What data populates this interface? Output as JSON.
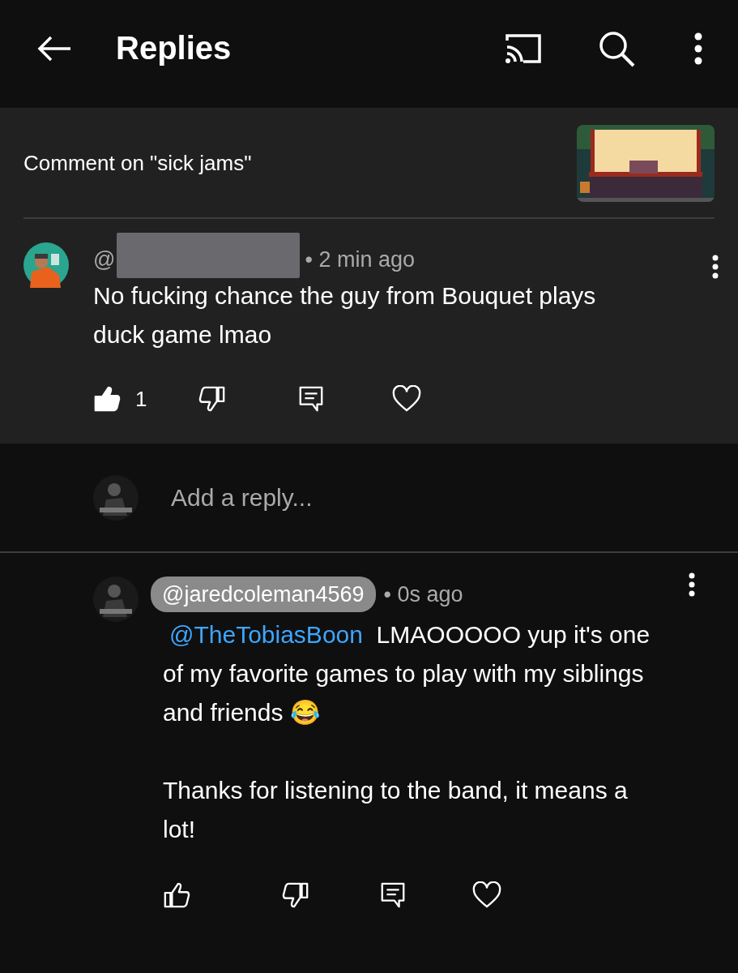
{
  "app_bar": {
    "title": "Replies"
  },
  "context": {
    "label": "Comment on \"sick jams\""
  },
  "comment": {
    "author": "@",
    "author_redacted": true,
    "time": "• 2 min ago",
    "text": "No fucking chance the guy from Bouquet plays duck game lmao",
    "likes": "1",
    "liked": true
  },
  "reply_box": {
    "placeholder": "Add a reply..."
  },
  "replies": [
    {
      "author": "@jaredcoleman4569",
      "author_highlighted": true,
      "time": "• 0s ago",
      "mention": "@TheTobiasBoon",
      "paragraphs": [
        "LMAOOOOO yup it's one of my favorite games to play with my siblings and friends 😂",
        "Thanks for listening to the band, it means a lot!"
      ],
      "liked": false
    }
  ]
}
